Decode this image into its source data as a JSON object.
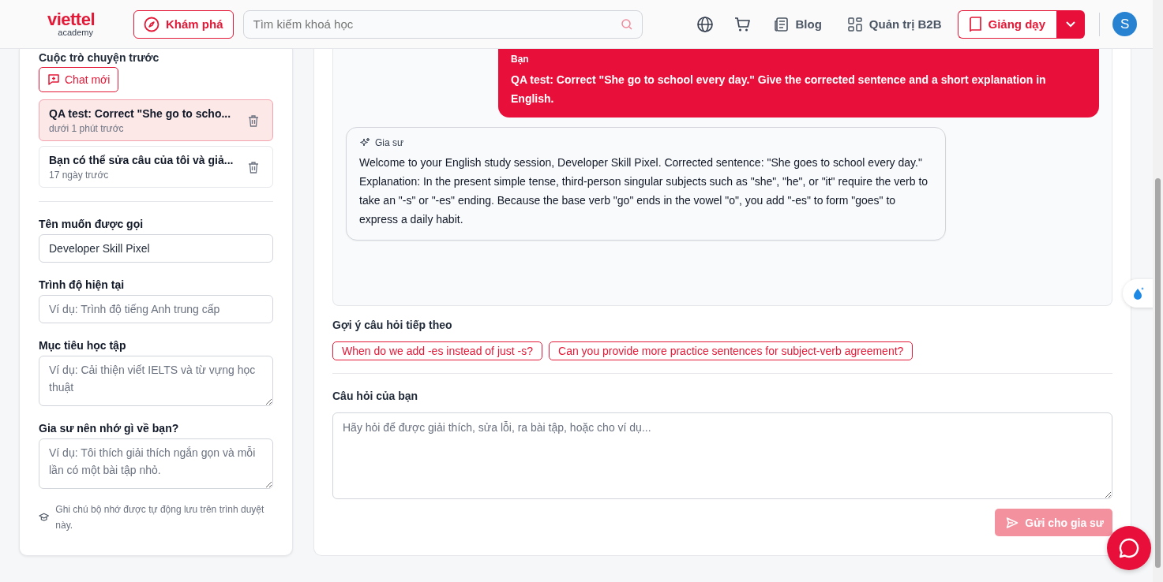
{
  "header": {
    "logo": {
      "brand": "viettel",
      "sub": "academy"
    },
    "explore_button": "Khám phá",
    "search": {
      "placeholder": "Tìm kiếm khoá học"
    },
    "nav": [
      {
        "label": "Blog",
        "kind": "blog"
      },
      {
        "label": "Quản trị B2B",
        "kind": "grid"
      }
    ],
    "teach_button": "Giảng dạy",
    "avatar": "S"
  },
  "sidebar": {
    "heading": "Cuộc trò chuyện trước",
    "new_chat": "Chat mới",
    "conversations": [
      {
        "title": "QA test: Correct \"She go to scho...",
        "time": "dưới 1 phút trước",
        "selected": true
      },
      {
        "title": "Bạn có thể sửa câu của tôi và giả...",
        "time": "17 ngày trước",
        "selected": false
      }
    ],
    "fields": [
      {
        "label": "Tên muốn được gọi",
        "kind": "input",
        "value": "Developer Skill Pixel"
      },
      {
        "label": "Trình độ hiện tại",
        "kind": "input",
        "placeholder": "Ví dụ: Trình độ tiếng Anh trung cấp"
      },
      {
        "label": "Mục tiêu học tập",
        "kind": "textarea",
        "placeholder": "Ví dụ: Cải thiện viết IELTS và từ vựng học thuật"
      },
      {
        "label": "Gia sư nên nhớ gì về bạn?",
        "kind": "textarea",
        "placeholder": "Ví dụ: Tôi thích giải thích ngắn gọn và mỗi lần có một bài tập nhỏ."
      }
    ],
    "note": "Ghi chú bộ nhớ được tự động lưu trên trình duyệt này."
  },
  "chat": {
    "messages": [
      {
        "kind": "user",
        "author": "Bạn",
        "text": "QA test: Correct \"She go to school every day.\" Give the corrected sentence and a short explanation in English."
      },
      {
        "kind": "assistant",
        "author": "Gia sư",
        "text": "Welcome to your English study session, Developer Skill Pixel. Corrected sentence: \"She goes to school every day.\" Explanation: In the present simple tense, third-person singular subjects such as \"she\", \"he\", or \"it\" require the verb to take an \"-s\" or \"-es\" ending. Because the base verb \"go\" ends in the vowel \"o\", you add \"-es\" to form \"goes\" to express a daily habit."
      }
    ],
    "suggestions_label": "Gợi ý câu hỏi tiếp theo",
    "suggestions": [
      "When do we add -es instead of just -s?",
      "Can you provide more practice sentences for subject-verb agreement?"
    ],
    "question": {
      "label": "Câu hỏi của bạn",
      "placeholder": "Hãy hỏi để được giải thích, sửa lỗi, ra bài tập, hoặc cho ví dụ..."
    },
    "send_button": {
      "label": "Gửi cho gia sư",
      "disabled": true
    }
  }
}
